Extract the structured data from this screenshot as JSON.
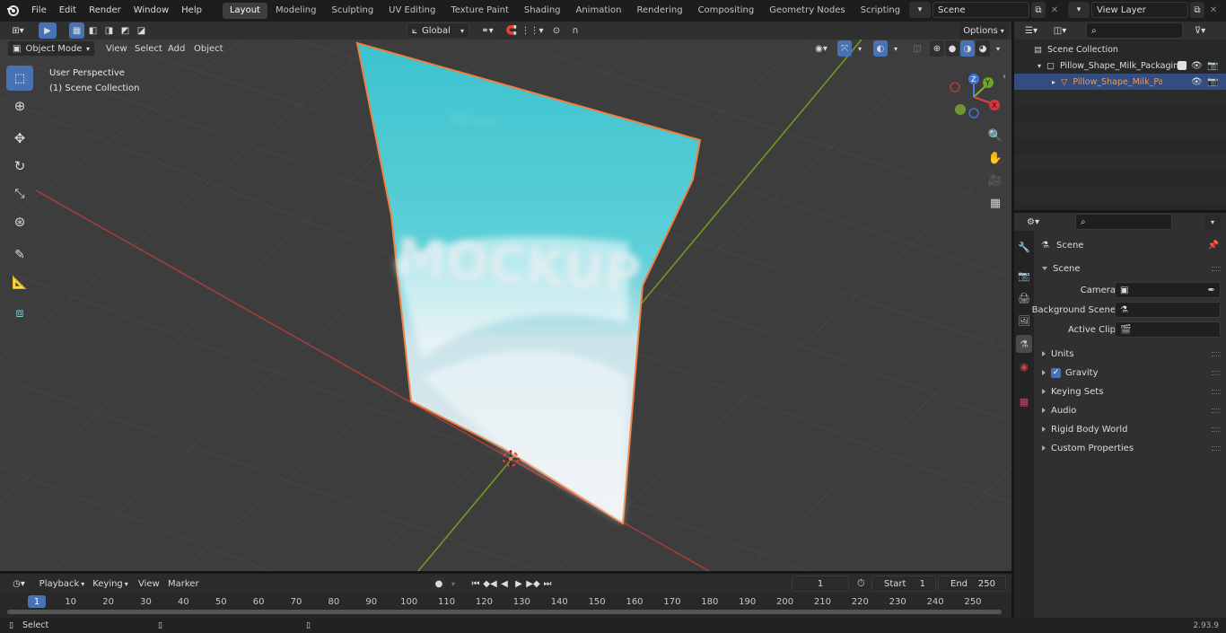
{
  "menus": [
    "File",
    "Edit",
    "Render",
    "Window",
    "Help"
  ],
  "workspaces": [
    "Layout",
    "Modeling",
    "Sculpting",
    "UV Editing",
    "Texture Paint",
    "Shading",
    "Animation",
    "Rendering",
    "Compositing",
    "Geometry Nodes",
    "Scripting"
  ],
  "active_workspace": "Layout",
  "scene_name": "Scene",
  "view_layer_name": "View Layer",
  "viewport": {
    "mode": "Object Mode",
    "menus": [
      "View",
      "Select",
      "Add",
      "Object"
    ],
    "transform_orientation": "Global",
    "options_label": "Options",
    "overlay_title": "User Perspective",
    "overlay_collection": "(1) Scene Collection",
    "package_text": "MOCKUP",
    "gizmo_axes": [
      "Z",
      "Y",
      "X"
    ]
  },
  "outliner": {
    "root": "Scene Collection",
    "collection": "Pillow_Shape_Milk_Packaging",
    "object": "Pillow_Shape_Milk_Packa"
  },
  "properties": {
    "context_title": "Scene",
    "panel_title": "Scene",
    "fields": [
      {
        "label": "Camera",
        "value": ""
      },
      {
        "label": "Background Scene",
        "value": ""
      },
      {
        "label": "Active Clip",
        "value": ""
      }
    ],
    "subpanels": [
      "Units",
      "Gravity",
      "Keying Sets",
      "Audio",
      "Rigid Body World",
      "Custom Properties"
    ],
    "gravity_checked": true
  },
  "timeline": {
    "menus": [
      "Playback",
      "Keying",
      "View",
      "Marker"
    ],
    "current_frame": "1",
    "start_label": "Start",
    "start_value": "1",
    "end_label": "End",
    "end_value": "250",
    "ruler": [
      "1",
      "10",
      "20",
      "30",
      "40",
      "50",
      "60",
      "70",
      "80",
      "90",
      "100",
      "110",
      "120",
      "130",
      "140",
      "150",
      "160",
      "170",
      "180",
      "190",
      "200",
      "210",
      "220",
      "230",
      "240",
      "250"
    ]
  },
  "status": {
    "left": "Select",
    "version": "2.93.9"
  },
  "colors": {
    "accent": "#4772b3",
    "selection_outline": "#f08040",
    "package": "#3ec4cf",
    "x_axis": "#b43a3a",
    "y_axis": "#7ca628"
  }
}
